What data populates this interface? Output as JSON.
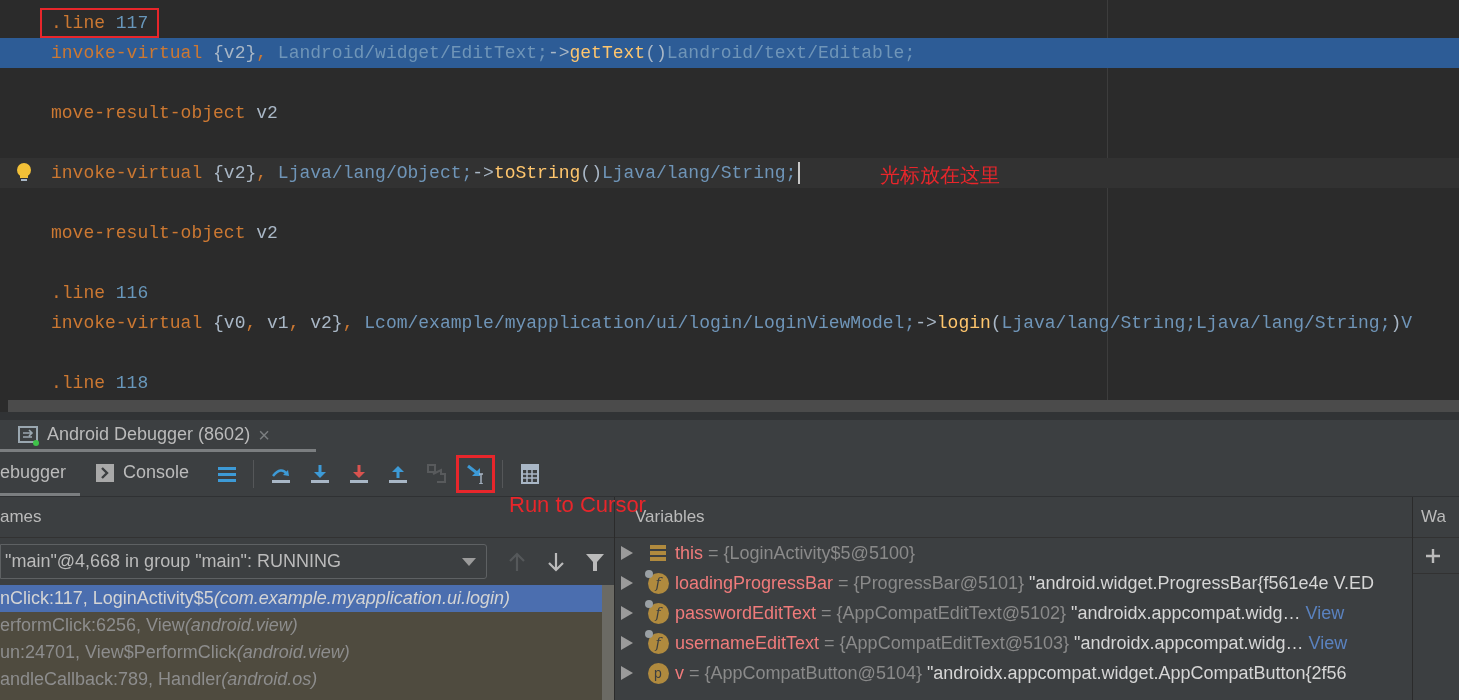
{
  "editor": {
    "lines": [
      {
        "selected": false,
        "caret": false,
        "boxed": true,
        "tokens": [
          {
            "kind": "kw",
            "text": ".line "
          },
          {
            "kind": "num",
            "text": "117"
          }
        ]
      },
      {
        "selected": true,
        "caret": false,
        "tokens": [
          {
            "kind": "kw",
            "text": "invoke-virtual "
          },
          {
            "kind": "reg",
            "text": "{v2}"
          },
          {
            "kind": "kw",
            "text": ", "
          },
          {
            "kind": "type",
            "text": "Landroid/widget/EditText;"
          },
          {
            "kind": "reg",
            "text": "->"
          },
          {
            "kind": "method",
            "text": "getText"
          },
          {
            "kind": "reg",
            "text": "()"
          },
          {
            "kind": "type",
            "text": "Landroid/text/Editable;"
          }
        ]
      },
      {
        "selected": false,
        "caret": false
      },
      {
        "selected": false,
        "caret": false,
        "tokens": [
          {
            "kind": "kw",
            "text": "move-result-object "
          },
          {
            "kind": "reg",
            "text": "v2"
          }
        ]
      },
      {
        "selected": false,
        "caret": false
      },
      {
        "selected": false,
        "caret": true,
        "bulb": true,
        "note": "光标放在这里",
        "tokens": [
          {
            "kind": "kw",
            "text": "invoke-virtual "
          },
          {
            "kind": "reg",
            "text": "{v2}"
          },
          {
            "kind": "kw",
            "text": ", "
          },
          {
            "kind": "type",
            "text": "Ljava/lang/Object;"
          },
          {
            "kind": "reg",
            "text": "->"
          },
          {
            "kind": "method",
            "text": "toString"
          },
          {
            "kind": "reg",
            "text": "()"
          },
          {
            "kind": "type",
            "text": "Ljava/lang/String;"
          }
        ]
      },
      {
        "selected": false,
        "caret": false
      },
      {
        "selected": false,
        "caret": false,
        "tokens": [
          {
            "kind": "kw",
            "text": "move-result-object "
          },
          {
            "kind": "reg",
            "text": "v2"
          }
        ]
      },
      {
        "selected": false,
        "caret": false
      },
      {
        "selected": false,
        "caret": false,
        "tokens": [
          {
            "kind": "kw",
            "text": ".line "
          },
          {
            "kind": "num",
            "text": "116"
          }
        ]
      },
      {
        "selected": false,
        "caret": false,
        "tokens": [
          {
            "kind": "kw",
            "text": "invoke-virtual "
          },
          {
            "kind": "reg",
            "text": "{v0"
          },
          {
            "kind": "kw",
            "text": ", "
          },
          {
            "kind": "reg",
            "text": "v1"
          },
          {
            "kind": "kw",
            "text": ", "
          },
          {
            "kind": "reg",
            "text": "v2}"
          },
          {
            "kind": "kw",
            "text": ", "
          },
          {
            "kind": "type",
            "text": "Lcom/example/myapplication/ui/login/LoginViewModel;"
          },
          {
            "kind": "reg",
            "text": "->"
          },
          {
            "kind": "method",
            "text": "login"
          },
          {
            "kind": "reg",
            "text": "("
          },
          {
            "kind": "type",
            "text": "Ljava/lang/String;Ljava/lang/String;"
          },
          {
            "kind": "reg",
            "text": ")"
          },
          {
            "kind": "type",
            "text": "V"
          }
        ]
      },
      {
        "selected": false,
        "caret": false
      },
      {
        "selected": false,
        "caret": false,
        "tokens": [
          {
            "kind": "kw",
            "text": ".line "
          },
          {
            "kind": "num",
            "text": "118"
          }
        ]
      }
    ]
  },
  "tool_window": {
    "title": "Android Debugger (8602)",
    "close": "×"
  },
  "tabs": [
    {
      "label": "ebugger",
      "kind": "debugger",
      "selected": true
    },
    {
      "label": "Console",
      "kind": "console",
      "selected": false
    }
  ],
  "toolbar": [
    {
      "kind": "layout",
      "disabled": false
    },
    {
      "kind": "separator"
    },
    {
      "kind": "step-over",
      "disabled": false
    },
    {
      "kind": "step-into",
      "disabled": false
    },
    {
      "kind": "force-step-into",
      "disabled": false
    },
    {
      "kind": "step-out",
      "disabled": false
    },
    {
      "kind": "drop-frame",
      "disabled": true
    },
    {
      "kind": "run-to-cursor",
      "disabled": false,
      "boxed": true,
      "note": "Run to Cursor"
    },
    {
      "kind": "separator"
    },
    {
      "kind": "evaluate",
      "disabled": false
    }
  ],
  "frames": {
    "header": "ames",
    "thread": "\"main\"@4,668 in group \"main\": RUNNING",
    "rows": [
      {
        "method": "nClick:117, LoginActivity$5",
        "package": "(com.example.myapplication.ui.login)",
        "selected": true,
        "library": false
      },
      {
        "method": "erformClick:6256, View",
        "package": "(android.view)",
        "selected": false,
        "library": true
      },
      {
        "method": "un:24701, View$PerformClick",
        "package": "(android.view)",
        "selected": false,
        "library": true
      },
      {
        "method": "andleCallback:789, Handler",
        "package": "(android.os)",
        "selected": false,
        "library": true
      }
    ]
  },
  "variables": {
    "header": "Variables",
    "rows": [
      {
        "kind": "this",
        "name": "this",
        "value": "= {LoginActivity$5@5100}"
      },
      {
        "kind": "field",
        "badge": "f",
        "final": true,
        "name": "loadingProgressBar",
        "value": "= {ProgressBar@5101}",
        "text": "\"android.widget.ProgressBar{f561e4e V.ED"
      },
      {
        "kind": "field",
        "badge": "f",
        "final": true,
        "name": "passwordEditText",
        "value": "= {AppCompatEditText@5102}",
        "text": "\"androidx.appcompat.widg…",
        "link": "View"
      },
      {
        "kind": "field",
        "badge": "f",
        "final": true,
        "name": "usernameEditText",
        "value": "= {AppCompatEditText@5103}",
        "text": "\"androidx.appcompat.widg…",
        "link": "View"
      },
      {
        "kind": "param",
        "badge": "p",
        "name": "v",
        "value": "= {AppCompatButton@5104}",
        "text": "\"androidx.appcompat.widget.AppCompatButton{2f56"
      }
    ]
  },
  "watches": {
    "header": "Wa"
  }
}
